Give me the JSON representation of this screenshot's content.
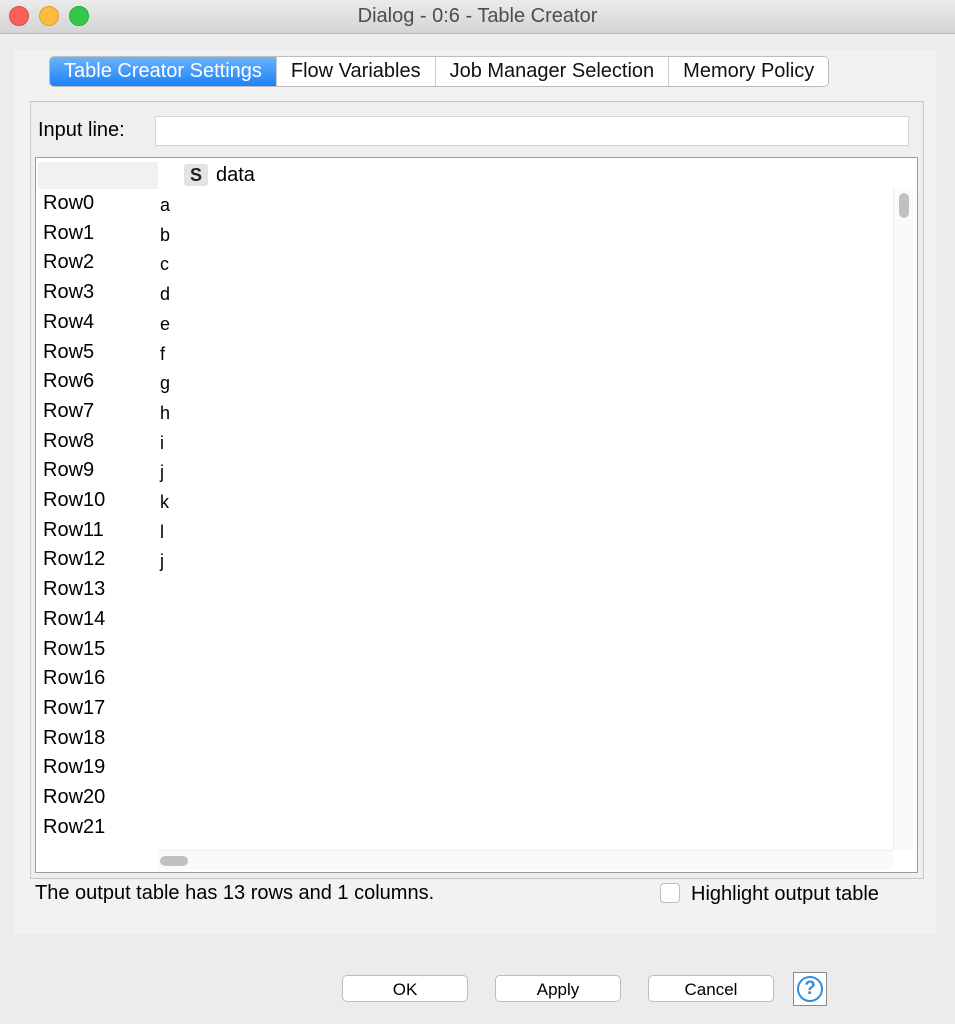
{
  "window": {
    "title": "Dialog - 0:6 - Table Creator"
  },
  "tabs": [
    {
      "label": "Table Creator Settings",
      "active": true
    },
    {
      "label": "Flow Variables"
    },
    {
      "label": "Job Manager Selection"
    },
    {
      "label": "Memory Policy"
    }
  ],
  "input": {
    "label": "Input line:",
    "value": ""
  },
  "table": {
    "column": {
      "type_icon": "S",
      "name": "data"
    },
    "row_headers": [
      "Row0",
      "Row1",
      "Row2",
      "Row3",
      "Row4",
      "Row5",
      "Row6",
      "Row7",
      "Row8",
      "Row9",
      "Row10",
      "Row11",
      "Row12",
      "Row13",
      "Row14",
      "Row15",
      "Row16",
      "Row17",
      "Row18",
      "Row19",
      "Row20",
      "Row21"
    ],
    "cells": [
      "a",
      "b",
      "c",
      "d",
      "e",
      "f",
      "g",
      "h",
      "i",
      "j",
      "k",
      "l",
      "j"
    ]
  },
  "status": {
    "text": "The output table has 13 rows and 1 columns.",
    "highlight_label": "Highlight output table",
    "highlight_checked": false
  },
  "buttons": {
    "ok": "OK",
    "apply": "Apply",
    "cancel": "Cancel",
    "help_icon": "question-circle-icon"
  },
  "colors": {
    "accent": "#1a82f7",
    "help": "#2f8ee0"
  }
}
